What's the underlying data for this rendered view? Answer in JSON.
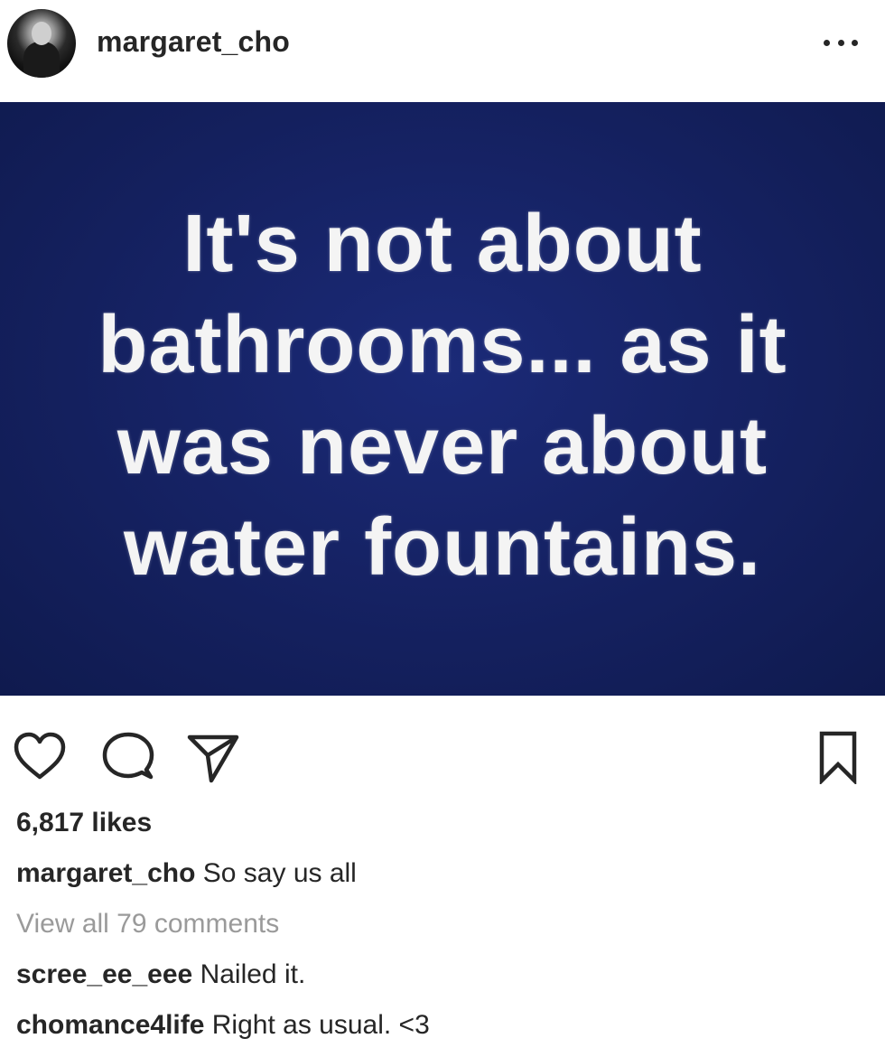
{
  "header": {
    "username": "margaret_cho",
    "more_label": "..."
  },
  "post": {
    "image_text_lines": [
      "It's not about",
      "bathrooms... as it",
      "was never about",
      "water fountains."
    ],
    "image_background_color": "#14205e",
    "image_text_color": "#f4f4f4"
  },
  "actions": {
    "like_icon": "heart-outline",
    "comment_icon": "speech-bubble",
    "share_icon": "paper-plane",
    "save_icon": "bookmark"
  },
  "likes": "6,817 likes",
  "caption": {
    "username": "margaret_cho",
    "text": "So say us all"
  },
  "view_all_comments": "View all 79 comments",
  "comments": [
    {
      "username": "scree_ee_eee",
      "text": "Nailed it."
    },
    {
      "username": "chomance4life",
      "text": "Right as usual. <3"
    }
  ]
}
